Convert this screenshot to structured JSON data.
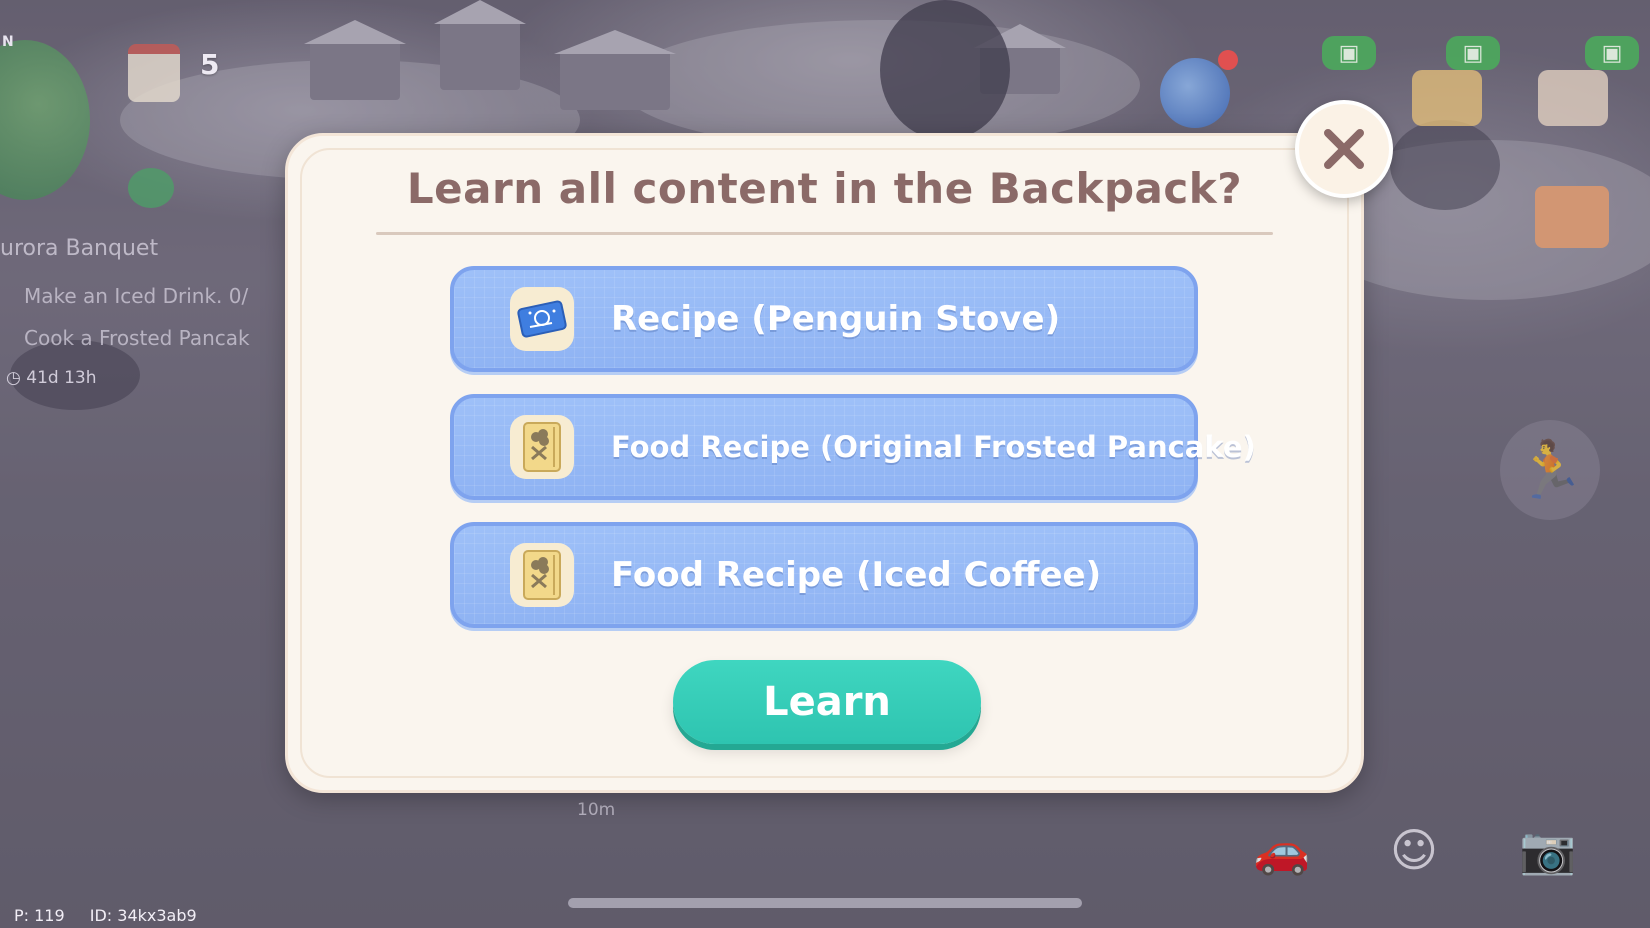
{
  "dialog": {
    "title": "Learn all content in the Backpack?",
    "items": [
      {
        "label": "Recipe (Penguin Stove)",
        "icon": "blueprint-icon"
      },
      {
        "label": "Food Recipe (Original Frosted Pancake)",
        "icon": "food-recipe-icon"
      },
      {
        "label": "Food Recipe (Iced Coffee)",
        "icon": "food-recipe-icon"
      }
    ],
    "learn_label": "Learn",
    "close_icon": "close-icon"
  },
  "hud": {
    "compass": "N",
    "event_count": "5",
    "quest": {
      "title": "urora Banquet",
      "tasks": [
        "Make an Iced Drink.  0/",
        "Cook a Frosted Pancak"
      ],
      "timer": "41d 13h"
    },
    "distance": "10m",
    "player": {
      "p": "P: 119",
      "id": "ID: 34kx3ab9"
    }
  },
  "colors": {
    "dialog_bg": "#faf5ee",
    "title": "#8b6a68",
    "item_bg": "#8fb3f3",
    "learn_button": "#2ec4b0",
    "close_x": "#8b6a68"
  }
}
